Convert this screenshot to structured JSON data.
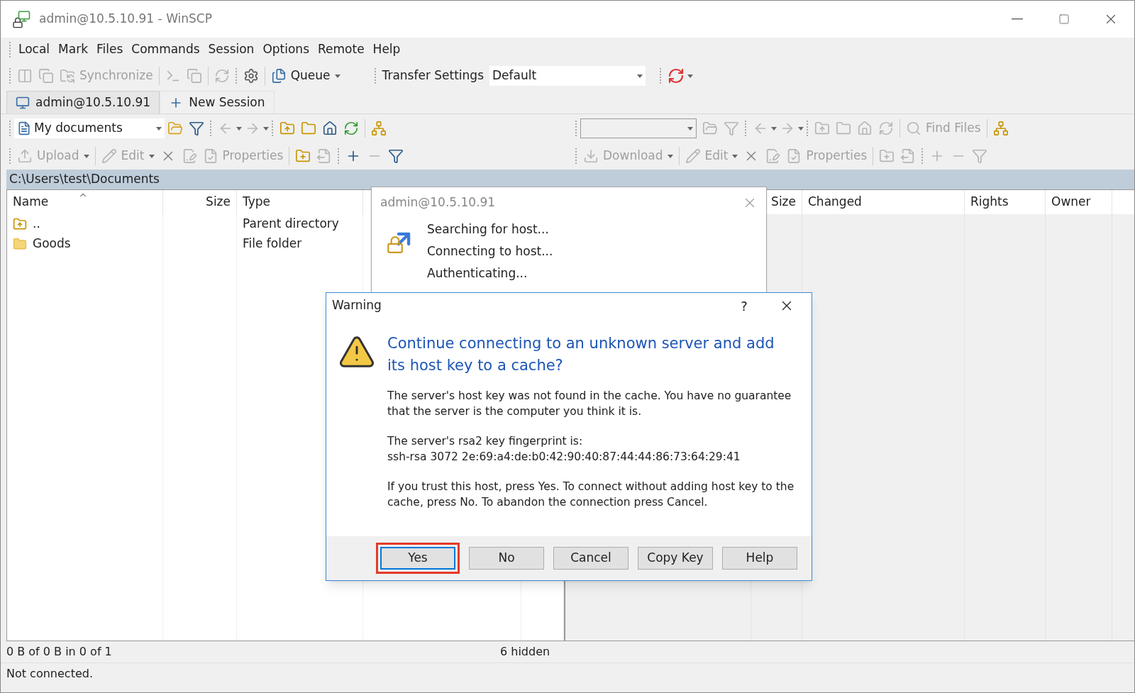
{
  "window": {
    "title": "admin@10.5.10.91 - WinSCP"
  },
  "menu": [
    "Local",
    "Mark",
    "Files",
    "Commands",
    "Session",
    "Options",
    "Remote",
    "Help"
  ],
  "toolbar": {
    "synchronize": {
      "label": "Synchronize",
      "disabled": true
    },
    "queue": {
      "label": "Queue",
      "disabled": false
    },
    "transfer_settings": {
      "label": "Transfer Settings",
      "value": "Default"
    }
  },
  "session_tabs": [
    {
      "label": "admin@10.5.10.91",
      "selected": true
    },
    {
      "label": "New Session",
      "selected": false
    }
  ],
  "local_panel": {
    "location": "My documents",
    "upload": {
      "label": "Upload",
      "disabled": true
    },
    "edit": {
      "label": "Edit",
      "disabled": true
    },
    "properties": {
      "label": "Properties",
      "disabled": true
    },
    "path": "C:\\Users\\test\\Documents",
    "columns": [
      "Name",
      "Size",
      "Type"
    ],
    "rows": [
      {
        "kind": "parent",
        "name": "..",
        "type": "Parent directory"
      },
      {
        "kind": "folder",
        "name": "Goods",
        "type": "File folder"
      }
    ]
  },
  "remote_panel": {
    "find_files": {
      "label": "Find Files",
      "disabled": true
    },
    "download": {
      "label": "Download",
      "disabled": true
    },
    "edit": {
      "label": "Edit",
      "disabled": true
    },
    "properties": {
      "label": "Properties",
      "disabled": true
    },
    "columns": [
      "Size",
      "Changed",
      "Rights",
      "Owner"
    ]
  },
  "status": {
    "selection": "0 B of 0 B in 0 of 1",
    "hidden": "6 hidden",
    "connection": "Not connected."
  },
  "progress_dialog": {
    "title": "admin@10.5.10.91",
    "steps": [
      "Searching for host...",
      "Connecting to host...",
      "Authenticating..."
    ]
  },
  "warning_dialog": {
    "title": "Warning",
    "help": "?",
    "heading": "Continue connecting to an unknown server and add its host key to a cache?",
    "message": "The server's host key was not found in the cache. You have no guarantee that the server is the computer you think it is.",
    "fingerprint_label": "The server's rsa2 key fingerprint is:",
    "fingerprint": "ssh-rsa 3072 2e:69:a4:de:b0:42:90:40:87:44:44:86:73:64:29:41",
    "instructions": "If you trust this host, press Yes. To connect without adding host key to the cache, press No. To abandon the connection press Cancel.",
    "buttons": [
      {
        "label": "Yes",
        "default": true,
        "highlighted": true
      },
      {
        "label": "No",
        "default": false,
        "highlighted": false
      },
      {
        "label": "Cancel",
        "default": false,
        "highlighted": false
      },
      {
        "label": "Copy Key",
        "default": false,
        "highlighted": false
      },
      {
        "label": "Help",
        "default": false,
        "highlighted": false
      }
    ]
  }
}
